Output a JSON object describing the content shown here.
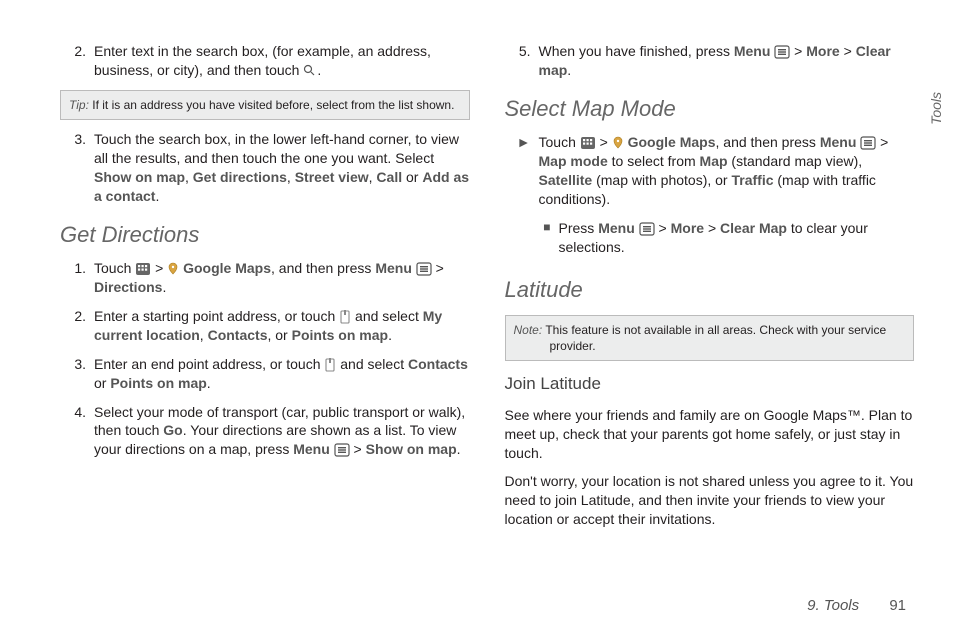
{
  "sideTab": "Tools",
  "footer": {
    "section": "9. Tools",
    "page": "91"
  },
  "left": {
    "step2": {
      "num": "2.",
      "text_a": "Enter text in the search box, (for example, an address, business, or city), and then touch ",
      "text_b": "."
    },
    "tip": {
      "label": "Tip:",
      "text": "If it is an address you have visited before, select from the list shown."
    },
    "step3": {
      "num": "3.",
      "a": "Touch the search box, in the lower left-hand corner, to view all the results, and then touch the one you want. Select ",
      "b": "Show on map",
      "c": ", ",
      "d": "Get directions",
      "e": ", ",
      "f": "Street view",
      "g": ", ",
      "h": "Call",
      "i": " or ",
      "j": "Add as a contact",
      "k": "."
    },
    "h_get": "Get Directions",
    "d1": {
      "num": "1.",
      "a": "Touch ",
      "b": " > ",
      "c": " ",
      "d": "Google Maps",
      "e": ", and then press ",
      "f": "Menu",
      "g": " ",
      "h": " > ",
      "i": "Directions",
      "j": "."
    },
    "d2": {
      "num": "2.",
      "a": "Enter a starting point address, or touch ",
      "b": " and select ",
      "c": "My current location",
      "d": ", ",
      "e": "Contacts",
      "f": ", or ",
      "g": "Points on map",
      "h": "."
    },
    "d3": {
      "num": "3.",
      "a": "Enter an end point address, or touch ",
      "b": " and select ",
      "c": "Contacts",
      "d": " or ",
      "e": "Points on map",
      "f": "."
    },
    "d4": {
      "num": "4.",
      "a": "Select your mode of transport (car, public transport or walk), then touch ",
      "b": "Go",
      "c": ". Your directions are shown as a list. To view your directions on a map, press ",
      "d": "Menu",
      "e": " ",
      "f": " > ",
      "g": "Show on map",
      "h": "."
    }
  },
  "right": {
    "step5": {
      "num": "5.",
      "a": "When you have finished, press ",
      "b": "Menu",
      "c": " ",
      "d": " > ",
      "e": "More",
      "f": " > ",
      "g": "Clear map",
      "h": "."
    },
    "h_sel": "Select Map Mode",
    "sel": {
      "a": "Touch ",
      "b": " > ",
      "c": " ",
      "d": "Google Maps",
      "e": ", and then press ",
      "f": "Menu",
      "g": " ",
      "h": " > ",
      "i": "Map mode",
      "j": " to select from ",
      "k": "Map",
      "l": " (standard map view), ",
      "m": "Satellite",
      "n": " (map with photos), or ",
      "o": "Traffic",
      "p": " (map with traffic conditions)."
    },
    "sel_sub": {
      "a": "Press ",
      "b": "Menu",
      "c": " ",
      "d": " > ",
      "e": "More",
      "f": " > ",
      "g": "Clear Map",
      "h": " to clear your selections."
    },
    "h_lat": "Latitude",
    "note": {
      "label": "Note:",
      "text": "This feature is not available in all areas. Check with your service provider."
    },
    "h_join": "Join Latitude",
    "p1": "See where your friends and family are on Google Maps™. Plan to meet up, check that your parents got home safely, or just stay in touch.",
    "p2": "Don't worry, your location is not shared unless you agree to it. You need to join Latitude, and then invite your friends to view your location or accept their invitations."
  }
}
